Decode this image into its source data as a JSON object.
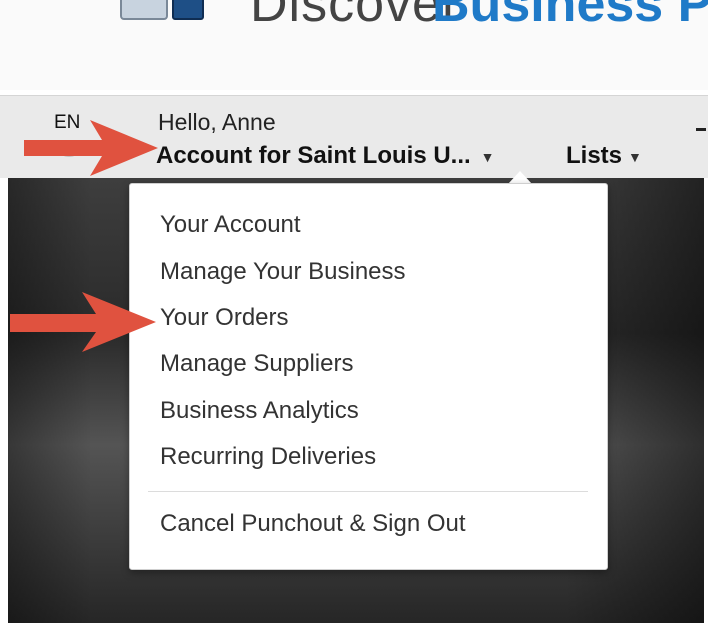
{
  "banner": {
    "discover": "Discover",
    "business": "Business Prime"
  },
  "nav": {
    "language": "EN",
    "greeting": "Hello, Anne",
    "account_label": "Account for Saint Louis U...",
    "lists_label": "Lists",
    "caret": "▼"
  },
  "dropdown": {
    "items": [
      "Your Account",
      "Manage Your Business",
      "Your Orders",
      "Manage Suppliers",
      "Business Analytics",
      "Recurring Deliveries"
    ],
    "footer_item": "Cancel Punchout & Sign Out"
  },
  "annotations": {
    "arrow_color": "#e0523f",
    "arrow_icon": "right-arrow-icon"
  }
}
